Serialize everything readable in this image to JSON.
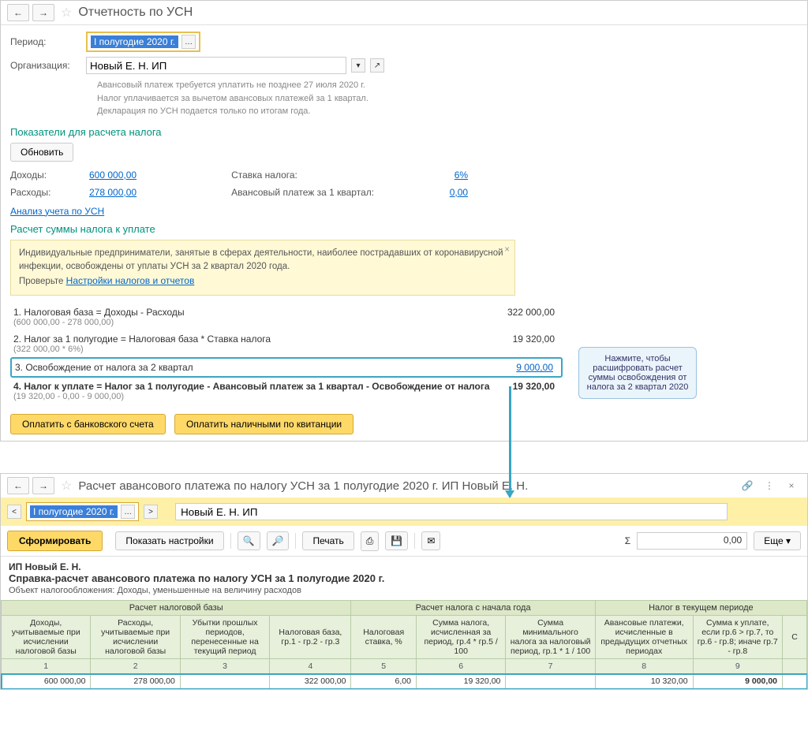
{
  "win1": {
    "title": "Отчетность по УСН",
    "period_label": "Период:",
    "period_value": "I полугодие 2020 г.",
    "org_label": "Организация:",
    "org_value": "Новый Е. Н. ИП",
    "info_line1": "Авансовый платеж требуется уплатить не позднее 27 июля 2020 г.",
    "info_line2": "Налог уплачивается за вычетом авансовых платежей за 1 квартал.",
    "info_line3": "Декларация по УСН подается только по итогам года.",
    "section1": "Показатели для расчета налога",
    "refresh": "Обновить",
    "income_label": "Доходы:",
    "income_value": "600 000,00",
    "expense_label": "Расходы:",
    "expense_value": "278 000,00",
    "rate_label": "Ставка налога:",
    "rate_value": "6%",
    "advance_label": "Авансовый платеж за 1 квартал:",
    "advance_value": "0,00",
    "analysis_link": "Анализ учета по УСН",
    "section2": "Расчет суммы налога к уплате",
    "notice_text": "Индивидуальные предприниматели, занятые в сферах деятельности, наиболее пострадавших от коронавирусной инфекции, освобождены от уплаты УСН за 2 квартал 2020 года.",
    "notice_check": "Проверьте ",
    "notice_link": "Настройки налогов и отчетов",
    "calc1_title": "1. Налоговая база = Доходы - Расходы",
    "calc1_sub": "(600 000,00 - 278 000,00)",
    "calc1_val": "322 000,00",
    "calc2_title": "2. Налог за 1 полугодие = Налоговая база * Ставка налога",
    "calc2_sub": "(322 000,00 * 6%)",
    "calc2_val": "19 320,00",
    "calc3_title": "3. Освобождение от налога за 2 квартал",
    "calc3_val": "9 000,00",
    "calc4_title": "4. Налог к уплате = Налог за 1 полугодие - Авансовый платеж за 1 квартал - Освобождение от налога",
    "calc4_sub": "(19 320,00 - 0,00 - 9 000,00)",
    "calc4_val": "19 320,00",
    "pay_bank": "Оплатить с банковского счета",
    "pay_cash": "Оплатить наличными по квитанции",
    "callout": "Нажмите, чтобы расшифровать расчет суммы освобождения от налога за 2 квартал 2020"
  },
  "win2": {
    "title": "Расчет  авансового платежа по налогу УСН за 1 полугодие 2020 г. ИП Новый Е. Н.",
    "period_value": "I полугодие 2020 г.",
    "org_value": "Новый Е. Н. ИП",
    "form_btn": "Сформировать",
    "settings_btn": "Показать настройки",
    "print_btn": "Печать",
    "sum_label": "Σ",
    "sum_value": "0,00",
    "more_btn": "Еще",
    "rep_org": "ИП Новый Е. Н.",
    "rep_title": "Справка-расчет авансового платежа по налогу УСН за 1 полугодие 2020 г.",
    "rep_sub": "Объект налогообложения:    Доходы, уменьшенные на величину расходов",
    "group1": "Расчет налоговой базы",
    "group2": "Расчет налога с начала года",
    "group3": "Налог в текущем периоде",
    "cols": {
      "c1": "Доходы, учитываемые при исчислении налоговой базы",
      "c2": "Расходы, учитываемые при исчислении налоговой базы",
      "c3": "Убытки прошлых периодов, перенесенные на текущий период",
      "c4": "Налоговая база, гр.1 - гр.2 - гр.3",
      "c5": "Налоговая ставка, %",
      "c6": "Сумма налога, исчисленная за период, гр.4 * гр.5 / 100",
      "c7": "Сумма минимального налога за налоговый период, гр.1 * 1 / 100",
      "c8": "Авансовые платежи, исчисленные в предыдущих отчетных периодах",
      "c9": "Сумма к уплате, если гр.6 > гр.7, то гр.6 - гр.8; иначе гр.7 - гр.8",
      "c10": "С"
    },
    "nums": [
      "1",
      "2",
      "3",
      "4",
      "5",
      "6",
      "7",
      "8",
      "9"
    ],
    "data": {
      "v1": "600 000,00",
      "v2": "278 000,00",
      "v3": "",
      "v4": "322 000,00",
      "v5": "6,00",
      "v6": "19 320,00",
      "v7": "",
      "v8": "10 320,00",
      "v9": "9 000,00"
    }
  }
}
